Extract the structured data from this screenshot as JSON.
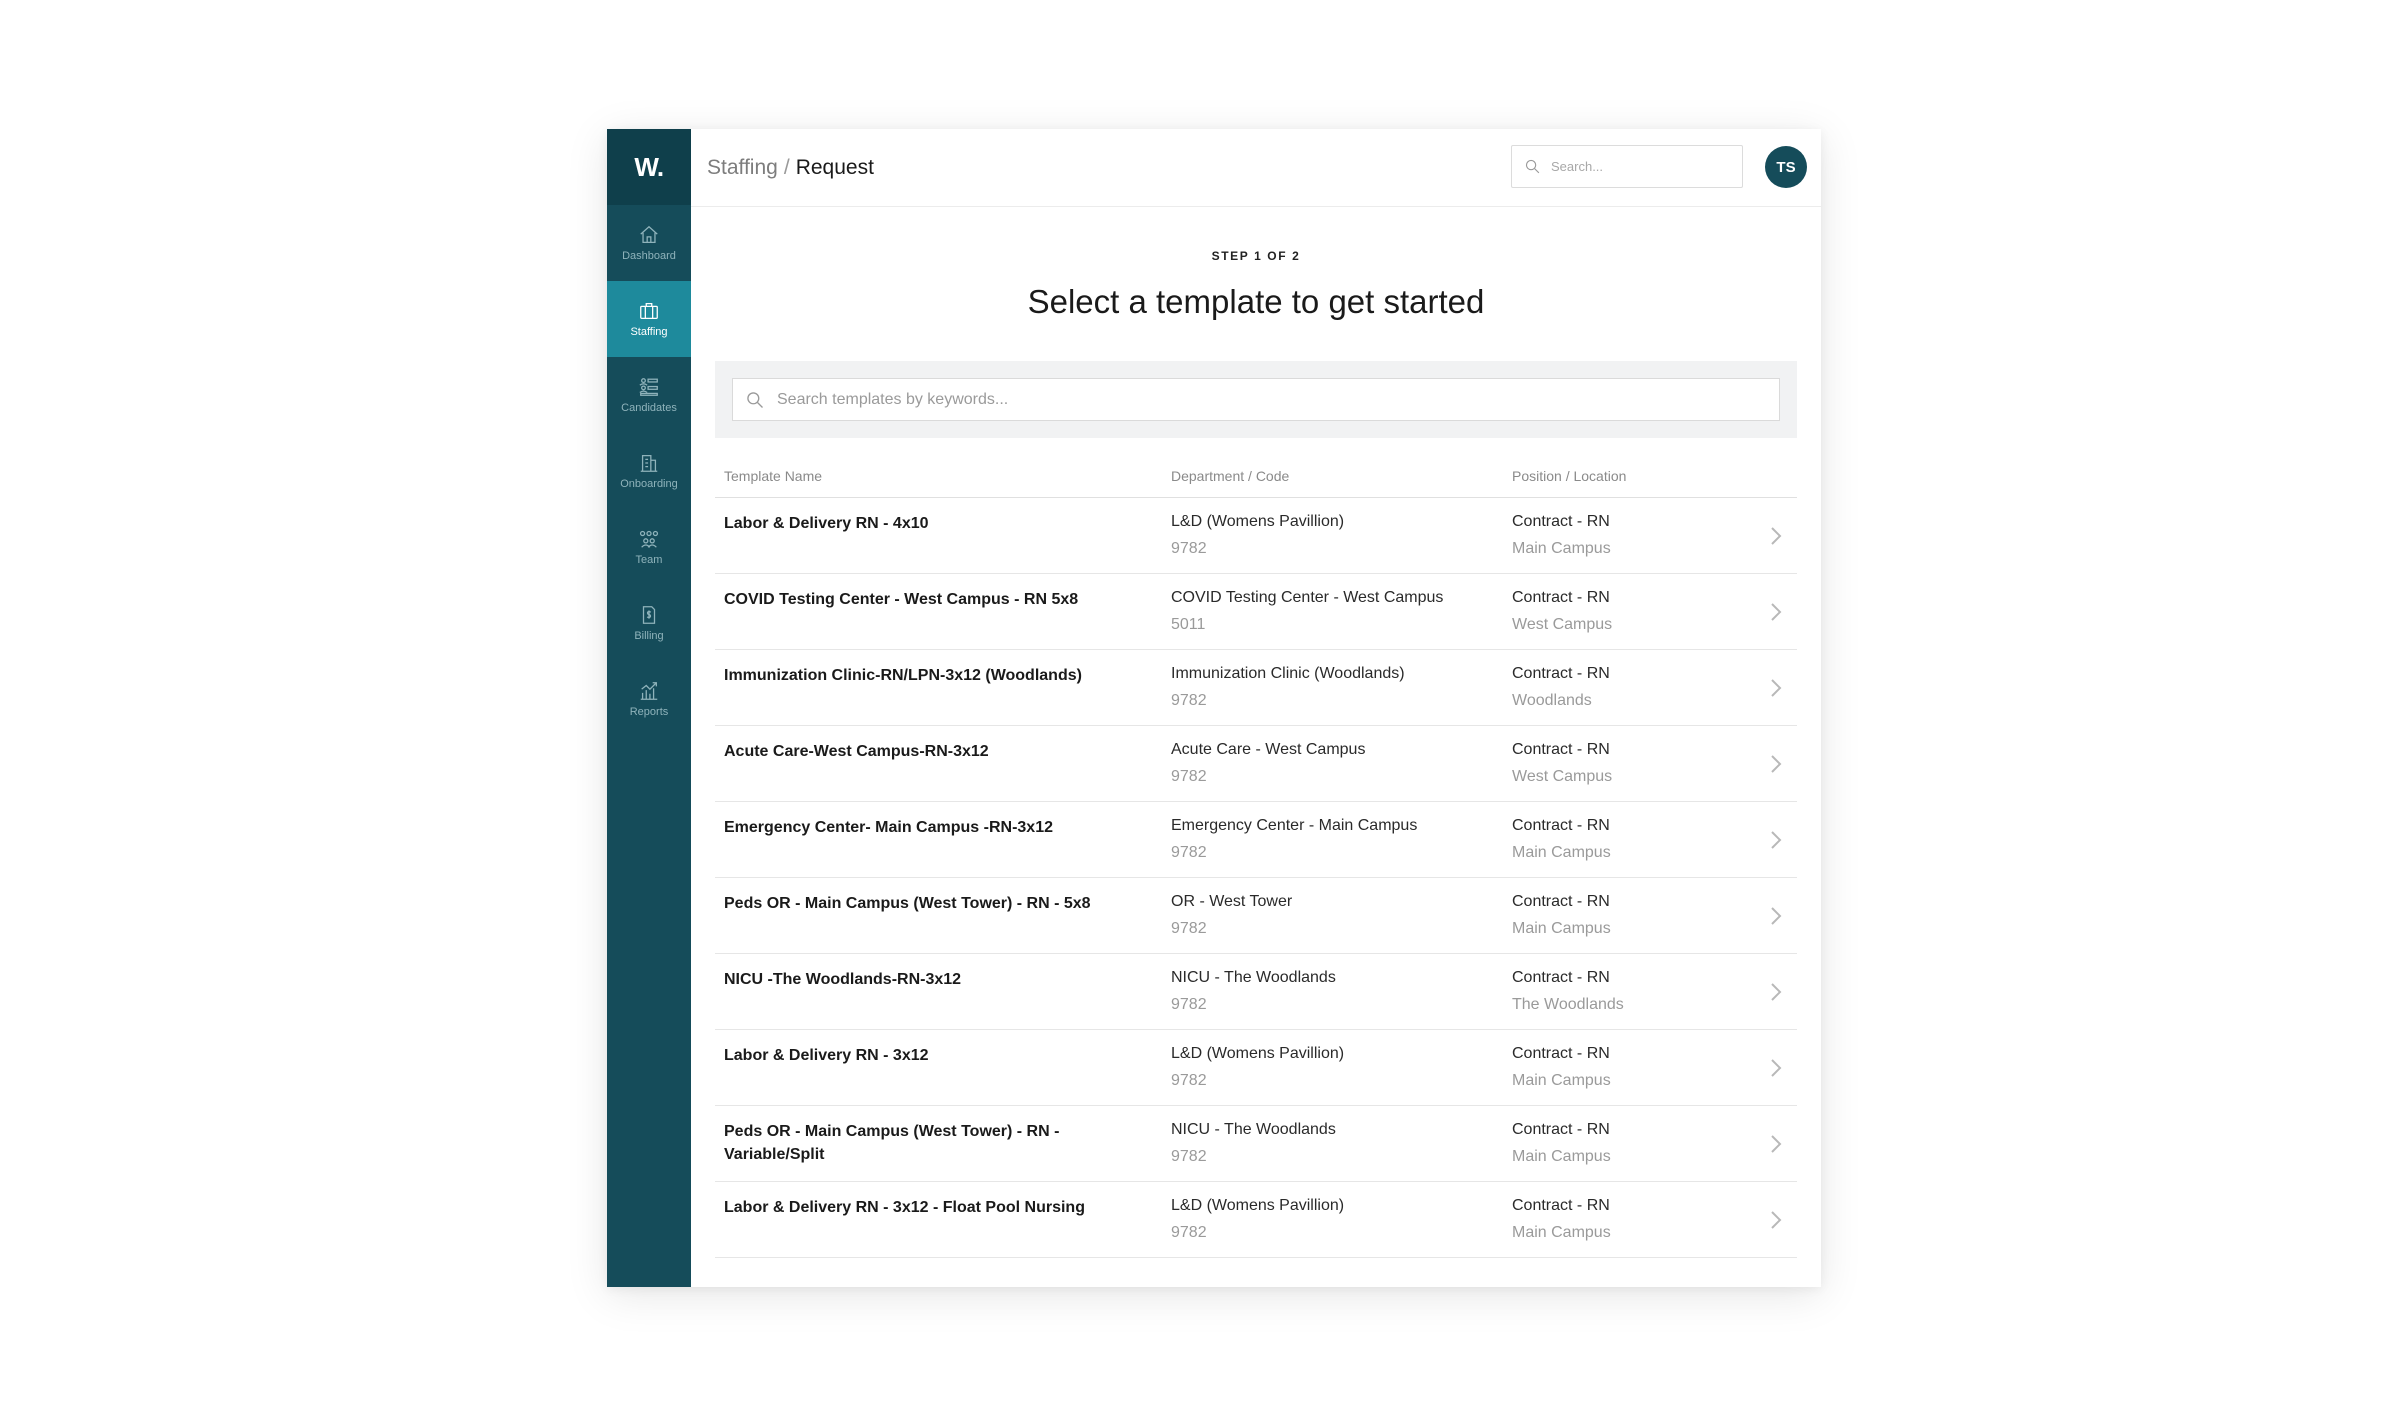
{
  "app": {
    "logo_text": "W."
  },
  "sidebar": {
    "items": [
      {
        "label": "Dashboard",
        "icon": "home-icon",
        "active": false
      },
      {
        "label": "Staffing",
        "icon": "briefcase-icon",
        "active": true
      },
      {
        "label": "Candidates",
        "icon": "candidates-icon",
        "active": false
      },
      {
        "label": "Onboarding",
        "icon": "building-icon",
        "active": false
      },
      {
        "label": "Team",
        "icon": "team-icon",
        "active": false
      },
      {
        "label": "Billing",
        "icon": "billing-icon",
        "active": false
      },
      {
        "label": "Reports",
        "icon": "reports-icon",
        "active": false
      }
    ]
  },
  "header": {
    "breadcrumb": {
      "parent": "Staffing",
      "separator": "/",
      "current": "Request"
    },
    "search_placeholder": "Search...",
    "avatar_initials": "TS"
  },
  "main": {
    "step": "STEP 1 OF 2",
    "title": "Select a template to get started",
    "template_search_placeholder": "Search templates by keywords..."
  },
  "table": {
    "columns": [
      "Template Name",
      "Department / Code",
      "Position / Location"
    ],
    "rows": [
      {
        "name": "Labor & Delivery RN - 4x10",
        "department": "L&D (Womens Pavillion)",
        "code": "9782",
        "position": "Contract - RN",
        "location": "Main Campus"
      },
      {
        "name": "COVID Testing Center - West Campus - RN 5x8",
        "department": "COVID Testing Center - West Campus",
        "code": "5011",
        "position": "Contract - RN",
        "location": "West Campus"
      },
      {
        "name": "Immunization Clinic-RN/LPN-3x12 (Woodlands)",
        "department": "Immunization Clinic (Woodlands)",
        "code": "9782",
        "position": "Contract - RN",
        "location": "Woodlands"
      },
      {
        "name": "Acute Care-West Campus-RN-3x12",
        "department": "Acute Care - West Campus",
        "code": "9782",
        "position": "Contract - RN",
        "location": "West Campus"
      },
      {
        "name": "Emergency Center- Main Campus -RN-3x12",
        "department": "Emergency Center - Main Campus",
        "code": "9782",
        "position": "Contract - RN",
        "location": "Main Campus"
      },
      {
        "name": "Peds OR - Main Campus (West Tower) - RN - 5x8",
        "department": "OR - West Tower",
        "code": "9782",
        "position": "Contract - RN",
        "location": "Main Campus"
      },
      {
        "name": "NICU -The Woodlands-RN-3x12",
        "department": "NICU - The Woodlands",
        "code": "9782",
        "position": "Contract - RN",
        "location": "The Woodlands"
      },
      {
        "name": "Labor & Delivery RN - 3x12",
        "department": "L&D (Womens Pavillion)",
        "code": "9782",
        "position": "Contract - RN",
        "location": "Main Campus"
      },
      {
        "name": "Peds OR - Main Campus (West Tower) - RN - Variable/Split",
        "department": "NICU - The Woodlands",
        "code": "9782",
        "position": "Contract - RN",
        "location": "Main Campus"
      },
      {
        "name": "Labor & Delivery RN - 3x12 - Float Pool Nursing",
        "department": "L&D (Womens Pavillion)",
        "code": "9782",
        "position": "Contract - RN",
        "location": "Main Campus"
      }
    ]
  },
  "colors": {
    "sidebar_bg": "#154c5a",
    "sidebar_active": "#1e8a9c",
    "logo_bg": "#0f3f4b",
    "avatar_bg": "#154c5a"
  }
}
